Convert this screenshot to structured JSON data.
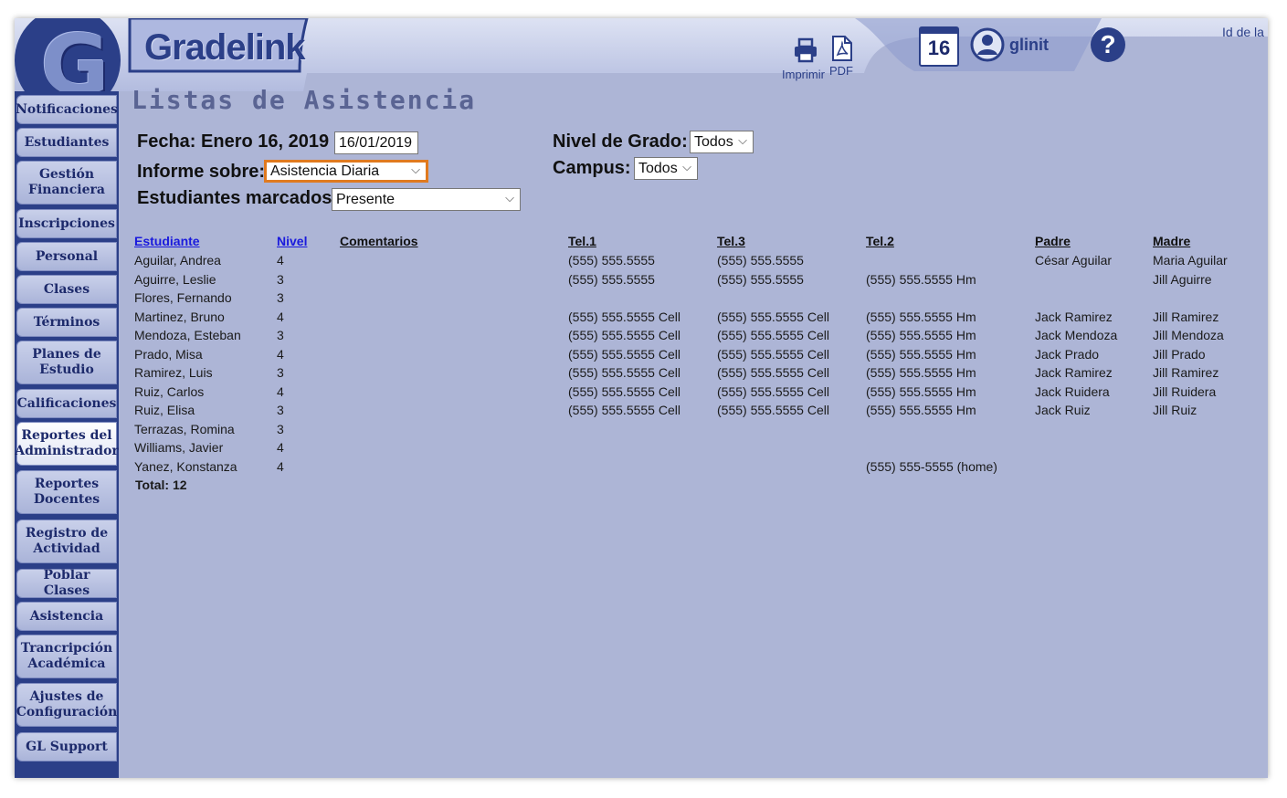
{
  "header": {
    "brand_letter": "G",
    "brand_name": "Gradelink",
    "print_label": "Imprimir",
    "pdf_label": "PDF",
    "calendar_day": "16",
    "user_name": "glinit",
    "help_glyph": "?",
    "id_label": "Id de la",
    "icons": [
      "print-icon",
      "pdf-icon",
      "calendar-icon",
      "user-icon",
      "help-icon"
    ]
  },
  "sidebar": {
    "items": [
      {
        "label": "Notificaciones"
      },
      {
        "label": "Estudiantes"
      },
      {
        "label": "Gestión Financiera"
      },
      {
        "label": "Inscripciones"
      },
      {
        "label": "Personal"
      },
      {
        "label": "Clases"
      },
      {
        "label": "Términos"
      },
      {
        "label": "Planes de Estudio"
      },
      {
        "label": "Calificaciones"
      },
      {
        "label": "Reportes del Administrador",
        "active": true
      },
      {
        "label": "Reportes Docentes"
      },
      {
        "label": "Registro de Actividad"
      },
      {
        "label": "Poblar Clases"
      },
      {
        "label": "Asistencia"
      },
      {
        "label": "Trancripción Académica"
      },
      {
        "label": "Ajustes de Configuración"
      },
      {
        "label": "GL Support"
      }
    ]
  },
  "page": {
    "title": "Listas de Asistencia",
    "fecha_label": "Fecha: Enero 16, 2019",
    "fecha_value": "16/01/2019",
    "informe_label": "Informe sobre:",
    "informe_value": "Asistencia Diaria",
    "marcados_label": "Estudiantes marcados",
    "marcados_value": "Presente",
    "nivel_label": "Nivel de Grado:",
    "nivel_value": "Todos",
    "campus_label": "Campus:",
    "campus_value": "Todos"
  },
  "table": {
    "headers": {
      "estudiante": "Estudiante",
      "nivel": "Nivel",
      "comentarios": "Comentarios",
      "tel1": "Tel.1",
      "tel3": "Tel.3",
      "tel2": "Tel.2",
      "padre": "Padre",
      "madre": "Madre"
    },
    "rows": [
      {
        "estudiante": "Aguilar, Andrea",
        "nivel": "4",
        "tel1": "(555) 555.5555",
        "tel3": "(555) 555.5555",
        "tel2": "",
        "padre": "César Aguilar",
        "madre": "Maria Aguilar"
      },
      {
        "estudiante": "Aguirre, Leslie",
        "nivel": "3",
        "tel1": "(555) 555.5555",
        "tel3": "(555) 555.5555",
        "tel2": "(555) 555.5555 Hm",
        "padre": "",
        "madre": "Jill Aguirre"
      },
      {
        "estudiante": "Flores, Fernando",
        "nivel": "3",
        "tel1": "",
        "tel3": "",
        "tel2": "",
        "padre": "",
        "madre": ""
      },
      {
        "estudiante": "Martinez, Bruno",
        "nivel": "4",
        "tel1": "(555) 555.5555 Cell",
        "tel3": "(555) 555.5555 Cell",
        "tel2": "(555) 555.5555 Hm",
        "padre": "Jack Ramirez",
        "madre": "Jill Ramirez"
      },
      {
        "estudiante": "Mendoza, Esteban",
        "nivel": "3",
        "tel1": "(555) 555.5555 Cell",
        "tel3": "(555) 555.5555 Cell",
        "tel2": "(555) 555.5555 Hm",
        "padre": "Jack Mendoza",
        "madre": "Jill Mendoza"
      },
      {
        "estudiante": "Prado, Misa",
        "nivel": "4",
        "tel1": "(555) 555.5555 Cell",
        "tel3": "(555) 555.5555 Cell",
        "tel2": "(555) 555.5555 Hm",
        "padre": "Jack Prado",
        "madre": "Jill Prado"
      },
      {
        "estudiante": "Ramirez, Luis",
        "nivel": "3",
        "tel1": "(555) 555.5555 Cell",
        "tel3": "(555) 555.5555 Cell",
        "tel2": "(555) 555.5555 Hm",
        "padre": "Jack Ramirez",
        "madre": "Jill Ramirez"
      },
      {
        "estudiante": "Ruiz, Carlos",
        "nivel": "4",
        "tel1": "(555) 555.5555 Cell",
        "tel3": "(555) 555.5555 Cell",
        "tel2": "(555) 555.5555 Hm",
        "padre": "Jack Ruidera",
        "madre": "Jill Ruidera"
      },
      {
        "estudiante": "Ruiz, Elisa",
        "nivel": "3",
        "tel1": "(555) 555.5555 Cell",
        "tel3": "(555) 555.5555 Cell",
        "tel2": "(555) 555.5555 Hm",
        "padre": "Jack Ruiz",
        "madre": "Jill Ruiz"
      },
      {
        "estudiante": "Terrazas, Romina",
        "nivel": "3",
        "tel1": "",
        "tel3": "",
        "tel2": "",
        "padre": "",
        "madre": ""
      },
      {
        "estudiante": "Williams, Javier",
        "nivel": "4",
        "tel1": "",
        "tel3": "",
        "tel2": "",
        "padre": "",
        "madre": ""
      },
      {
        "estudiante": "Yanez, Konstanza",
        "nivel": "4",
        "tel1": "",
        "tel3": "",
        "tel2": "(555) 555-5555 (home)",
        "padre": "",
        "madre": ""
      }
    ],
    "total": "Total: 12"
  },
  "colors": {
    "navy": "#2b3f88",
    "background": "#adb5d6",
    "highlight": "#e07a1f",
    "link": "#1a1add"
  }
}
